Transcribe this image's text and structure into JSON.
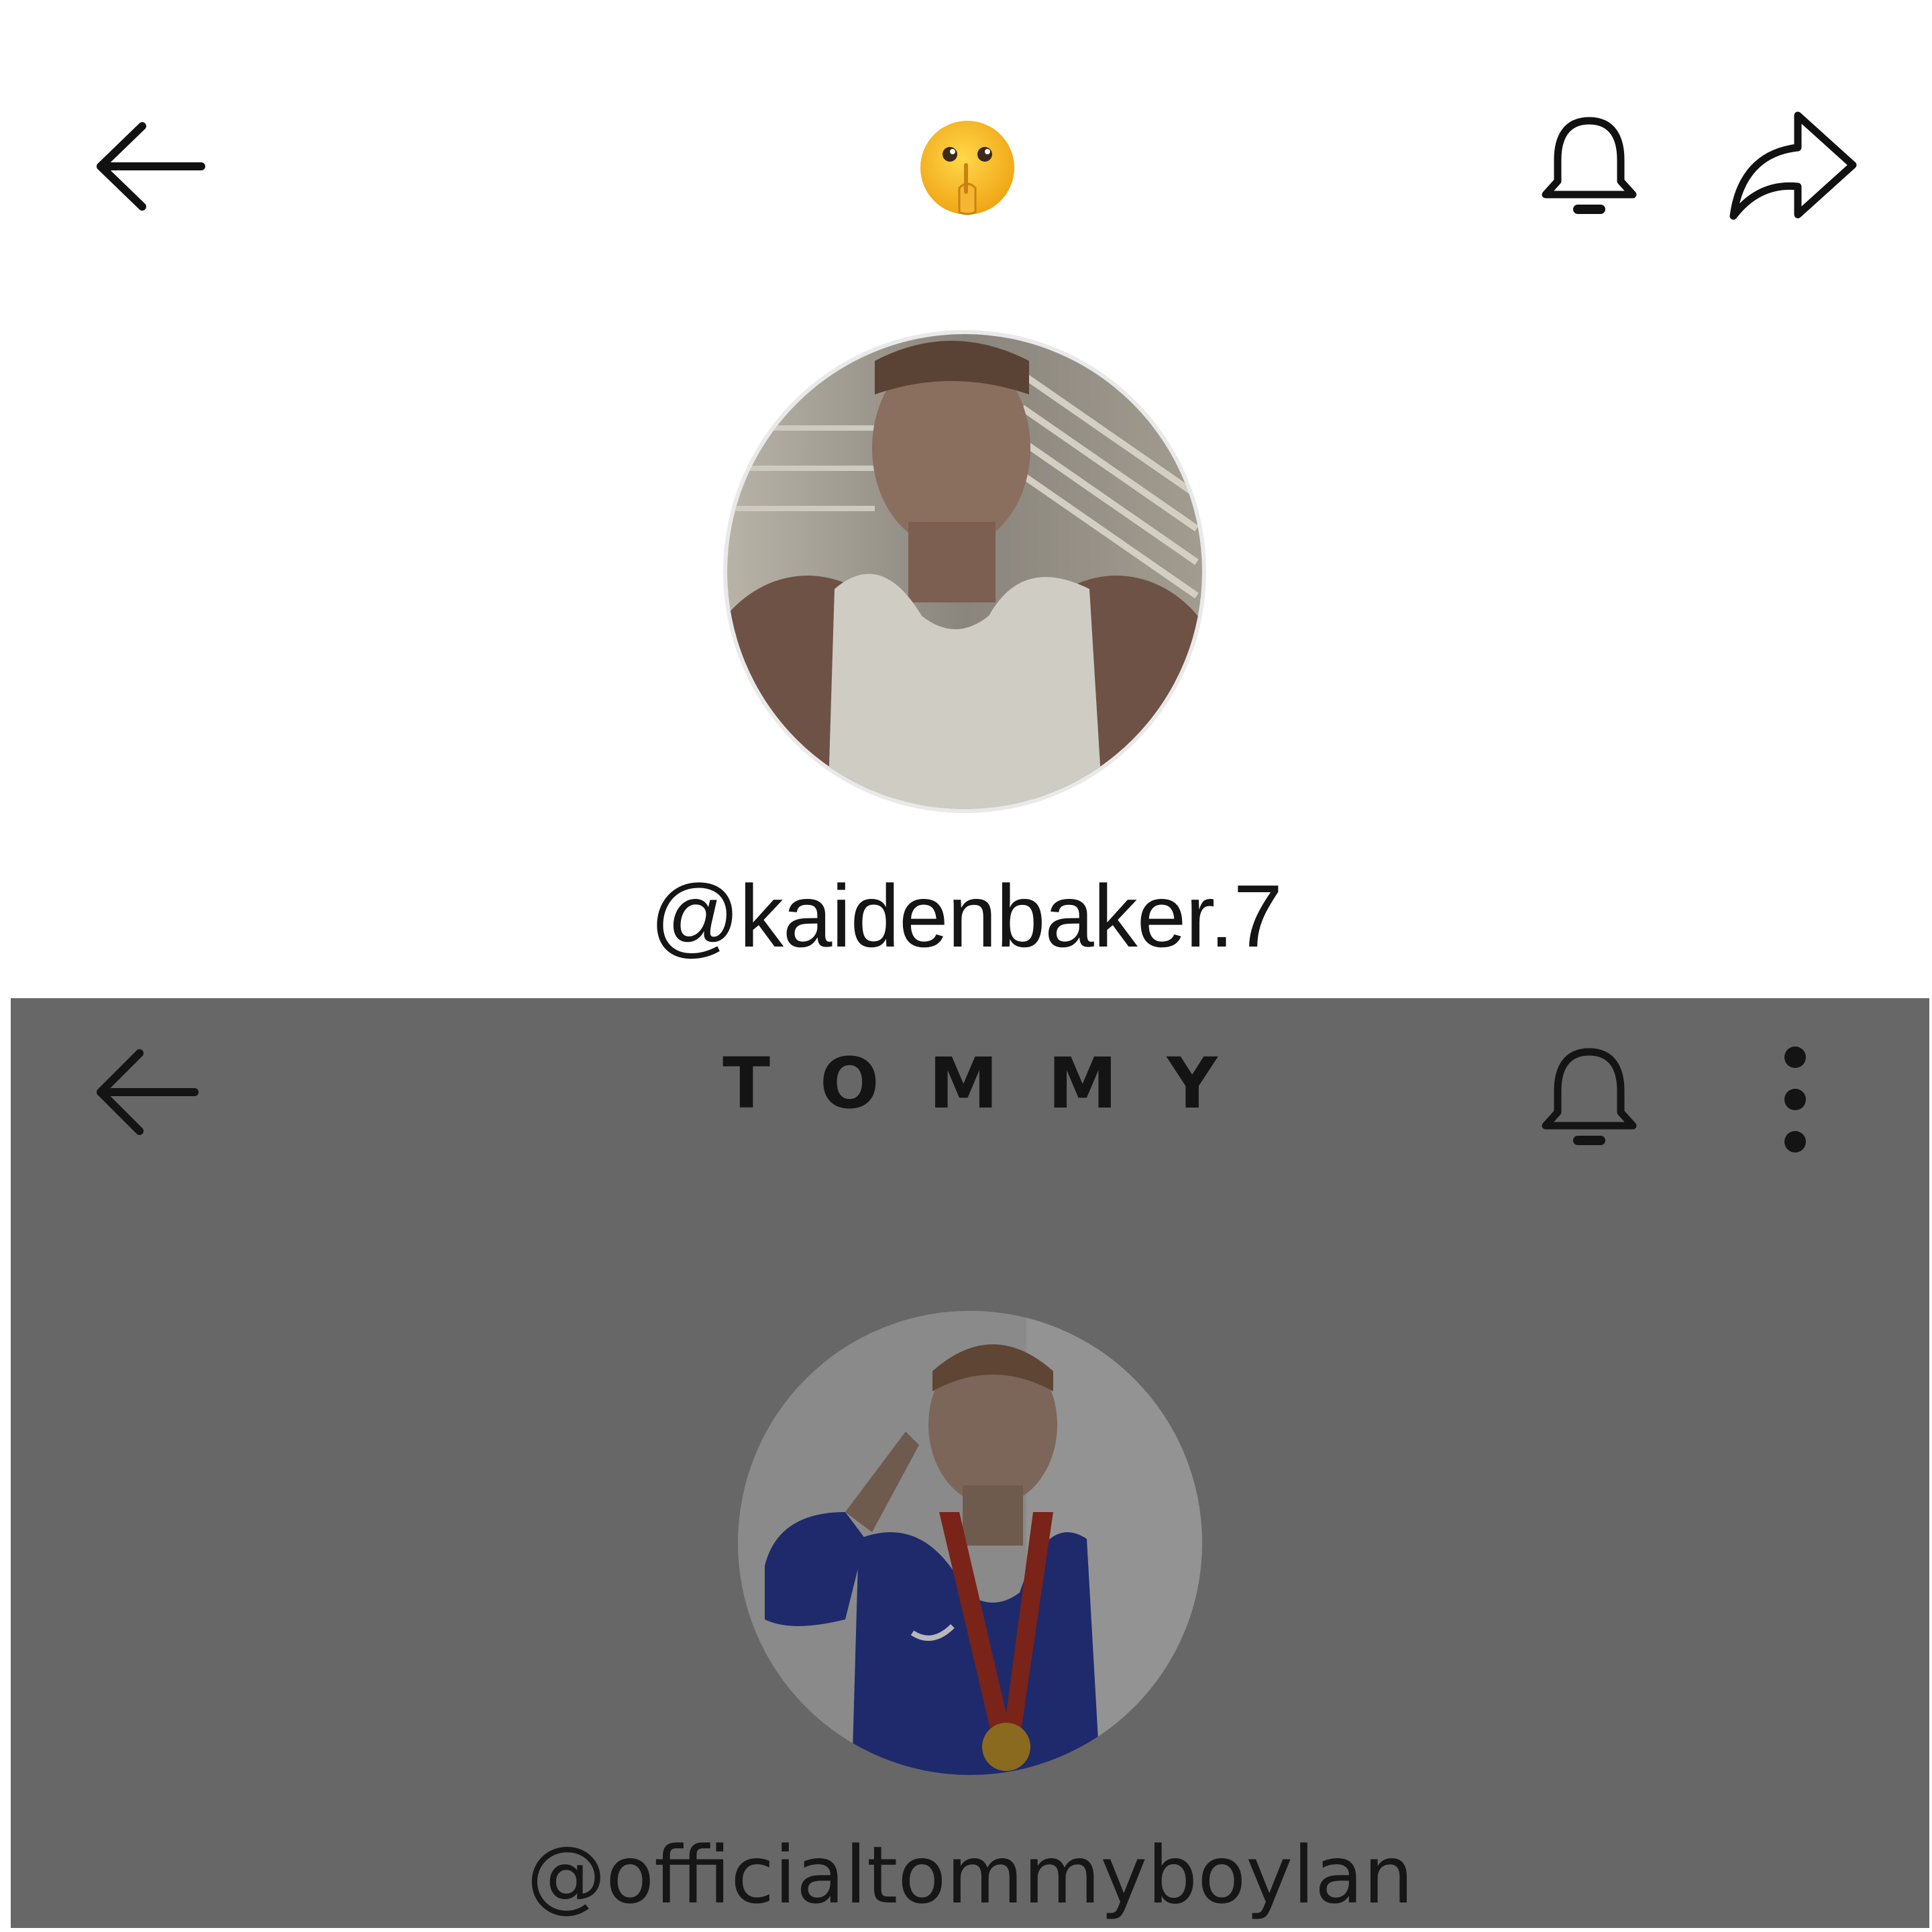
{
  "top_profile": {
    "header": {
      "back_icon": "arrow-left-icon",
      "title_emoji": "🫢",
      "bell_icon": "bell-icon",
      "share_icon": "share-arrow-icon"
    },
    "avatar": "profile-photo",
    "username": "@kaidenbaker.7"
  },
  "bottom_profile": {
    "header": {
      "back_icon": "arrow-left-icon",
      "title": "TOMMY",
      "bell_icon": "bell-icon",
      "menu_icon": "more-vertical-icon"
    },
    "avatar": "profile-photo",
    "username": "@officialtommyboylan"
  },
  "colors": {
    "overlay_gray": "#676767",
    "text_dark": "#151515",
    "background": "#ffffff"
  }
}
